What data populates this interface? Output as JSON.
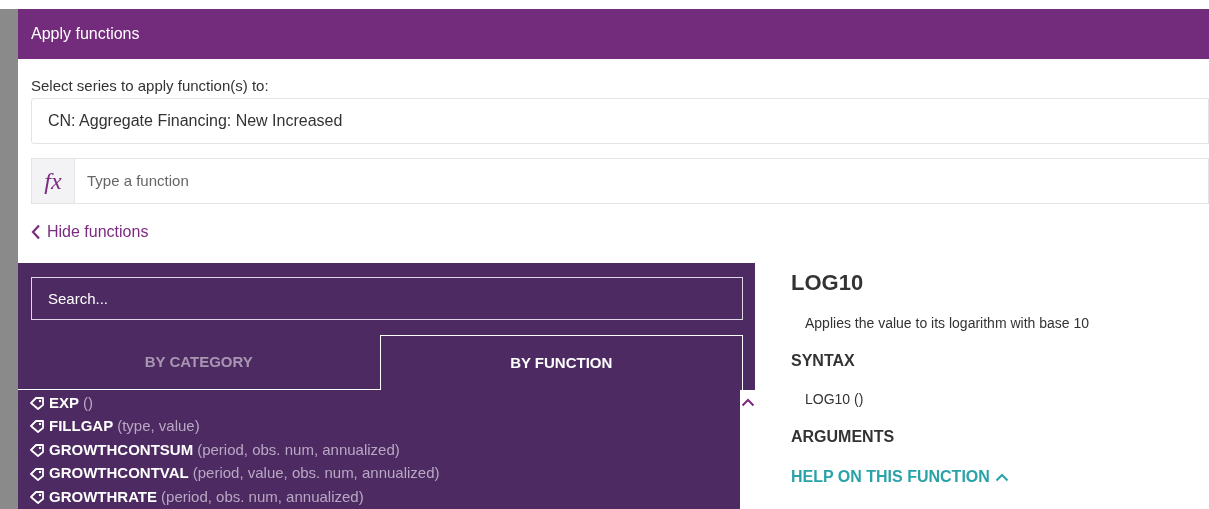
{
  "dialog": {
    "title": "Apply functions"
  },
  "series": {
    "label": "Select series to apply function(s) to:",
    "value": "CN: Aggregate Financing: New Increased"
  },
  "function_input": {
    "icon_text": "fx",
    "placeholder": "Type a function"
  },
  "toggle_link": "Hide functions",
  "function_browser": {
    "search": {
      "placeholder": "Search..."
    },
    "tabs": [
      {
        "label": "BY CATEGORY",
        "selected": false
      },
      {
        "label": "BY FUNCTION",
        "selected": true
      }
    ],
    "functions": [
      {
        "name": "EXP",
        "args": "()"
      },
      {
        "name": "FILLGAP",
        "args": "(type, value)"
      },
      {
        "name": "GROWTHCONTSUM",
        "args": "(period, obs. num, annualized)"
      },
      {
        "name": "GROWTHCONTVAL",
        "args": "(period, value, obs. num, annualized)"
      },
      {
        "name": "GROWTHRATE",
        "args": "(period, obs. num, annualized)"
      }
    ]
  },
  "details": {
    "title": "LOG10",
    "description": "Applies the value to its logarithm with base 10",
    "syntax_heading": "SYNTAX",
    "syntax": "LOG10 ()",
    "arguments_heading": "ARGUMENTS",
    "help_link": "HELP ON THIS FUNCTION"
  }
}
